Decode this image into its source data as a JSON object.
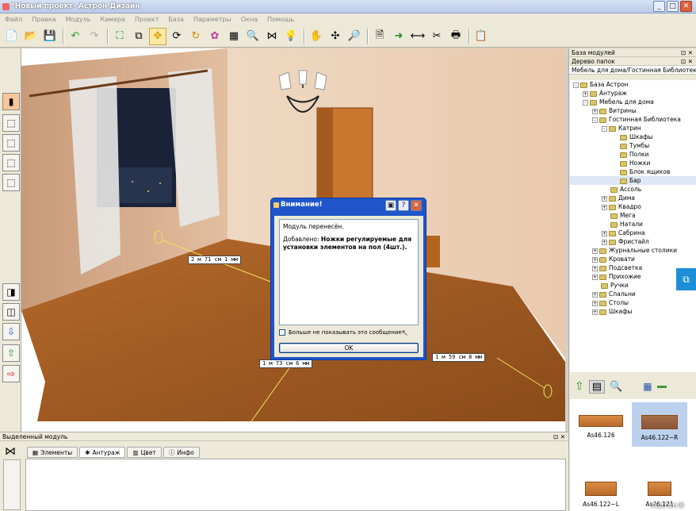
{
  "window": {
    "title": "*Новый проект- Астрон Дизайн",
    "min": "_",
    "max": "□",
    "close": "✕"
  },
  "menu": [
    "Файл",
    "Правка",
    "Модуль",
    "Камера",
    "Проект",
    "База",
    "Параметры",
    "Окна",
    "Помощь"
  ],
  "viewport": {
    "dimensions": [
      "2 м 71 см 1 мм",
      "1 м 73 см 6 мм",
      "1 м 59 см 8 мм"
    ]
  },
  "dialog": {
    "title": "Внимание!",
    "line1": "Модуль перенесён.",
    "added_prefix": "Добавлено:",
    "added_bold": "Ножки регулируемые для установки элементов на пол (4шт.).",
    "checkbox_label": "Больше не показывать это сообщение",
    "ok_label": "OK"
  },
  "right_panel": {
    "modules_header": "База модулей",
    "tree_header": "Дерево папок",
    "path": "Мебель для дома/Гостинная Библиотека/Ка",
    "tree": [
      {
        "label": "База Астрон",
        "level": 0,
        "exp": "-"
      },
      {
        "label": "Антураж",
        "level": 1,
        "exp": "+"
      },
      {
        "label": "Мебель для дома",
        "level": 1,
        "exp": "-"
      },
      {
        "label": "Витрины",
        "level": 2,
        "exp": "+"
      },
      {
        "label": "Гостинная Библиотека",
        "level": 2,
        "exp": "-"
      },
      {
        "label": "Катрин",
        "level": 3,
        "exp": "-"
      },
      {
        "label": "Шкафы",
        "level": 4,
        "exp": ""
      },
      {
        "label": "Тумбы",
        "level": 4,
        "exp": ""
      },
      {
        "label": "Полки",
        "level": 4,
        "exp": ""
      },
      {
        "label": "Ножки",
        "level": 4,
        "exp": ""
      },
      {
        "label": "Блок ящиков",
        "level": 4,
        "exp": ""
      },
      {
        "label": "Бар",
        "level": 4,
        "exp": "",
        "selected": true
      },
      {
        "label": "Ассоль",
        "level": 3,
        "exp": ""
      },
      {
        "label": "Дима",
        "level": 3,
        "exp": "+"
      },
      {
        "label": "Квадро",
        "level": 3,
        "exp": "+"
      },
      {
        "label": "Мега",
        "level": 3,
        "exp": ""
      },
      {
        "label": "Натали",
        "level": 3,
        "exp": ""
      },
      {
        "label": "Сабрина",
        "level": 3,
        "exp": "+"
      },
      {
        "label": "Фристайл",
        "level": 3,
        "exp": "+"
      },
      {
        "label": "Журнальные столики",
        "level": 2,
        "exp": "+"
      },
      {
        "label": "Кровати",
        "level": 2,
        "exp": "+"
      },
      {
        "label": "Подсветка",
        "level": 2,
        "exp": "+"
      },
      {
        "label": "Прихожие",
        "level": 2,
        "exp": "+"
      },
      {
        "label": "Ручки",
        "level": 2,
        "exp": ""
      },
      {
        "label": "Спальни",
        "level": 2,
        "exp": "+"
      },
      {
        "label": "Столы",
        "level": 2,
        "exp": "+"
      },
      {
        "label": "Шкафы",
        "level": 2,
        "exp": "+"
      }
    ],
    "thumbs": [
      "As46.126",
      "As46.122~R",
      "As46.122~L",
      "As46.121"
    ]
  },
  "bottom_panel": {
    "header": "Выделенный модуль",
    "tabs": [
      "Элементы",
      "Антураж",
      "Цвет",
      "Инфо"
    ]
  },
  "watermark": "Astron®"
}
